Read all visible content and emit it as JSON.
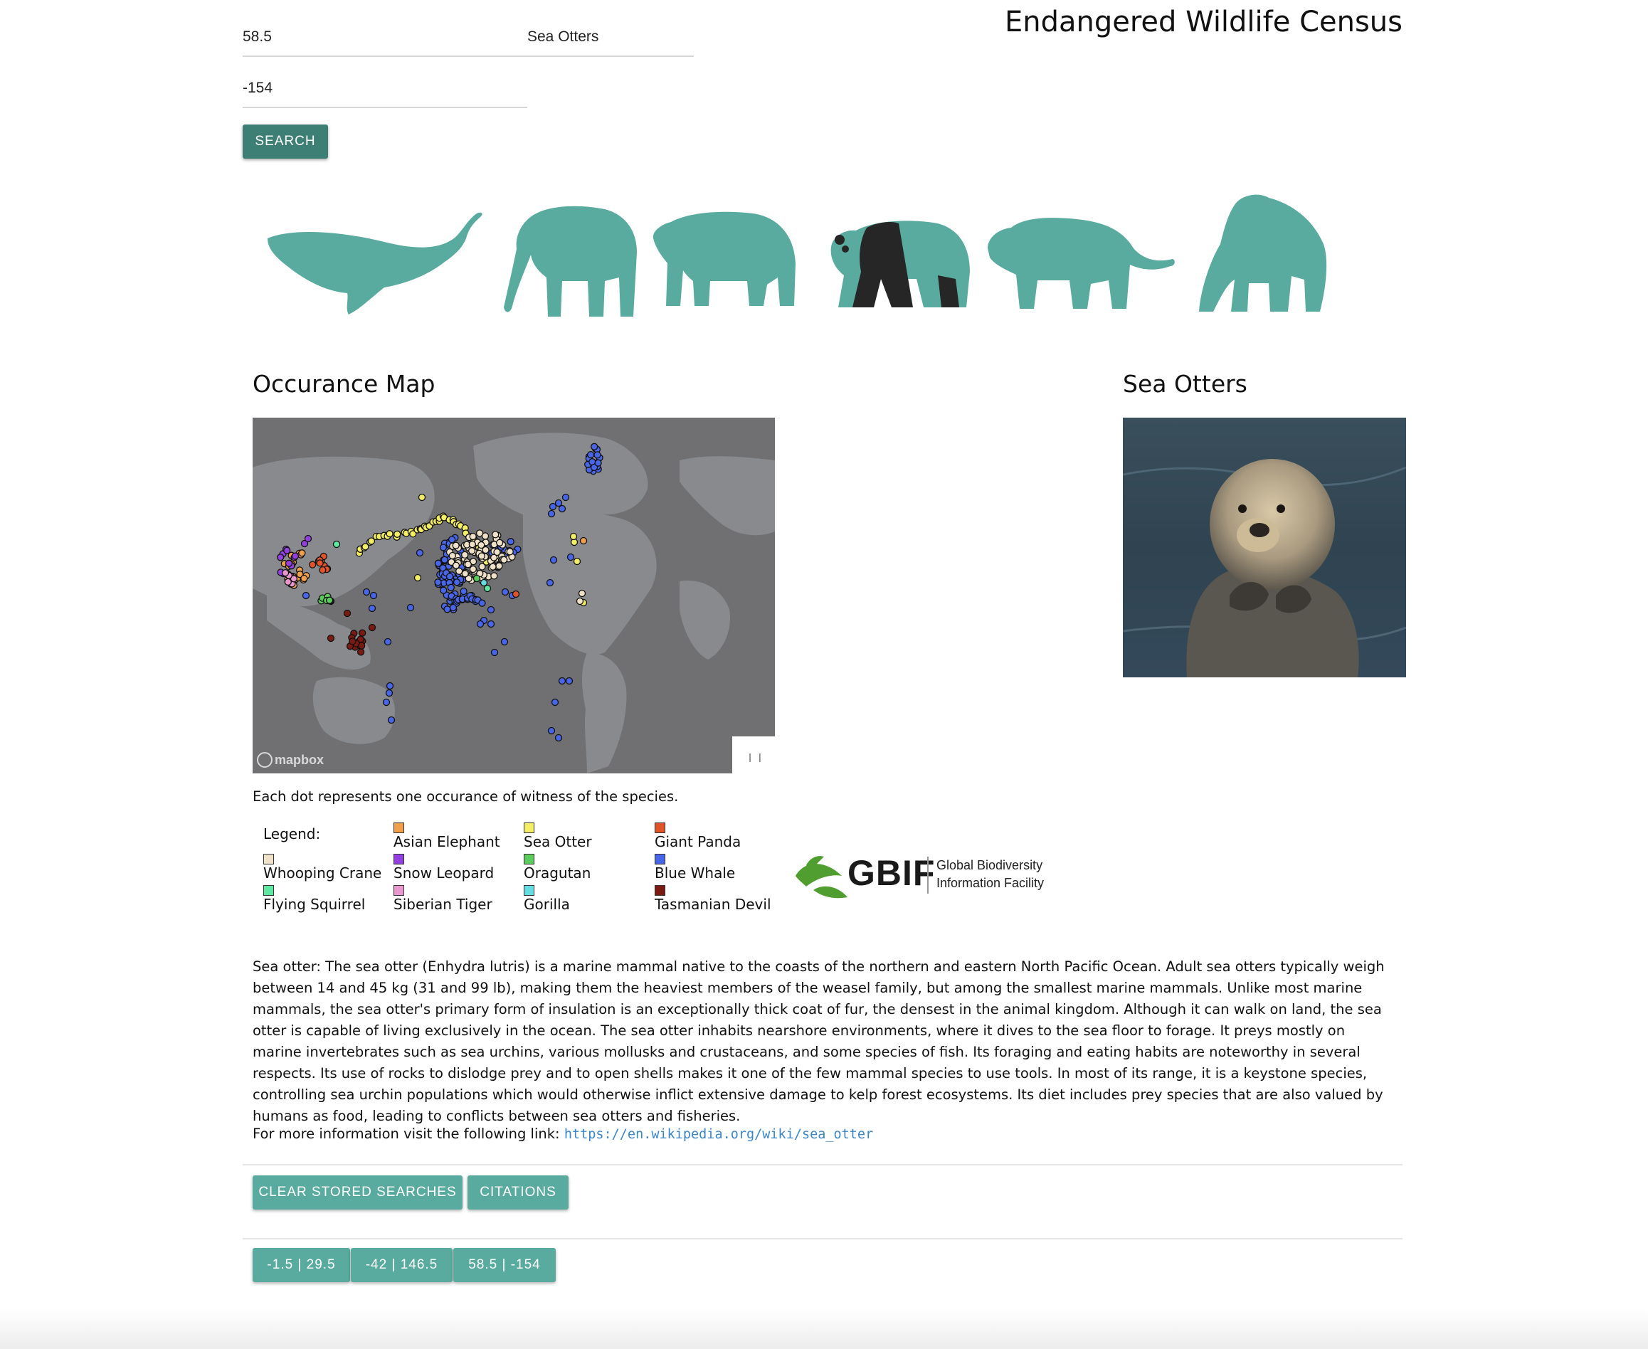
{
  "header": {
    "title": "Endangered Wildlife Census"
  },
  "search": {
    "latitude_value": "58.5",
    "longitude_value": "-154",
    "species_value": "Sea Otters",
    "button_label": "SEARCH"
  },
  "animals": [
    "whale-icon",
    "elephant-icon",
    "bear-icon",
    "panda-icon",
    "tiger-icon",
    "gorilla-icon"
  ],
  "map_section": {
    "heading": "Occurance Map",
    "attribution": "mapbox",
    "caption": "Each dot represents one occurance of witness of the species."
  },
  "photo_section": {
    "heading": "Sea Otters"
  },
  "legend": {
    "title": "Legend:",
    "items": [
      {
        "label": "Whooping Crane",
        "color": "#efe2c8"
      },
      {
        "label": "Flying Squirrel",
        "color": "#5ee8a0"
      },
      {
        "label": "Asian Elephant",
        "color": "#f0a04a"
      },
      {
        "label": "Snow Leopard",
        "color": "#9340e0"
      },
      {
        "label": "Siberian Tiger",
        "color": "#e898cc"
      },
      {
        "label": "Sea Otter",
        "color": "#f4ee66"
      },
      {
        "label": "Oragutan",
        "color": "#5ccc5c"
      },
      {
        "label": "Gorilla",
        "color": "#66dde0"
      },
      {
        "label": "Giant Panda",
        "color": "#e0542a"
      },
      {
        "label": "Blue Whale",
        "color": "#4a66e8"
      },
      {
        "label": "Tasmanian Devil",
        "color": "#7a1a12"
      }
    ]
  },
  "gbif": {
    "name": "GBIF",
    "line1": "Global Biodiversity",
    "line2": "Information Facility"
  },
  "description": {
    "text": "Sea otter: The sea otter (Enhydra lutris) is a marine mammal native to the coasts of the northern and eastern North Pacific Ocean. Adult sea otters typically weigh between 14 and 45 kg (31 and 99 lb), making them the heaviest members of the weasel family, but among the smallest marine mammals. Unlike most marine mammals, the sea otter's primary form of insulation is an exceptionally thick coat of fur, the densest in the animal kingdom. Although it can walk on land, the sea otter is capable of living exclusively in the ocean. The sea otter inhabits nearshore environments, where it dives to the sea floor to forage. It preys mostly on marine invertebrates such as sea urchins, various mollusks and crustaceans, and some species of fish. Its foraging and eating habits are noteworthy in several respects. Its use of rocks to dislodge prey and to open shells makes it one of the few mammal species to use tools. In most of its range, it is a keystone species, controlling sea urchin populations which would otherwise inflict extensive damage to kelp forest ecosystems. Its diet includes prey species that are also valued by humans as food, leading to conflicts between sea otters and fisheries.",
    "more_info": "For more information visit the following link:",
    "link": "https://en.wikipedia.org/wiki/sea_otter"
  },
  "actions": {
    "clear_label": "CLEAR STORED SEARCHES",
    "citations_label": "CITATIONS"
  },
  "stored_searches": [
    "-1.5 | 29.5",
    "-42 | 146.5",
    "58.5 | -154"
  ],
  "colors": {
    "accent": "#5aab9f",
    "accent_dark": "#3d7f75",
    "map_bg": "#707073",
    "link": "#3a86c8"
  }
}
